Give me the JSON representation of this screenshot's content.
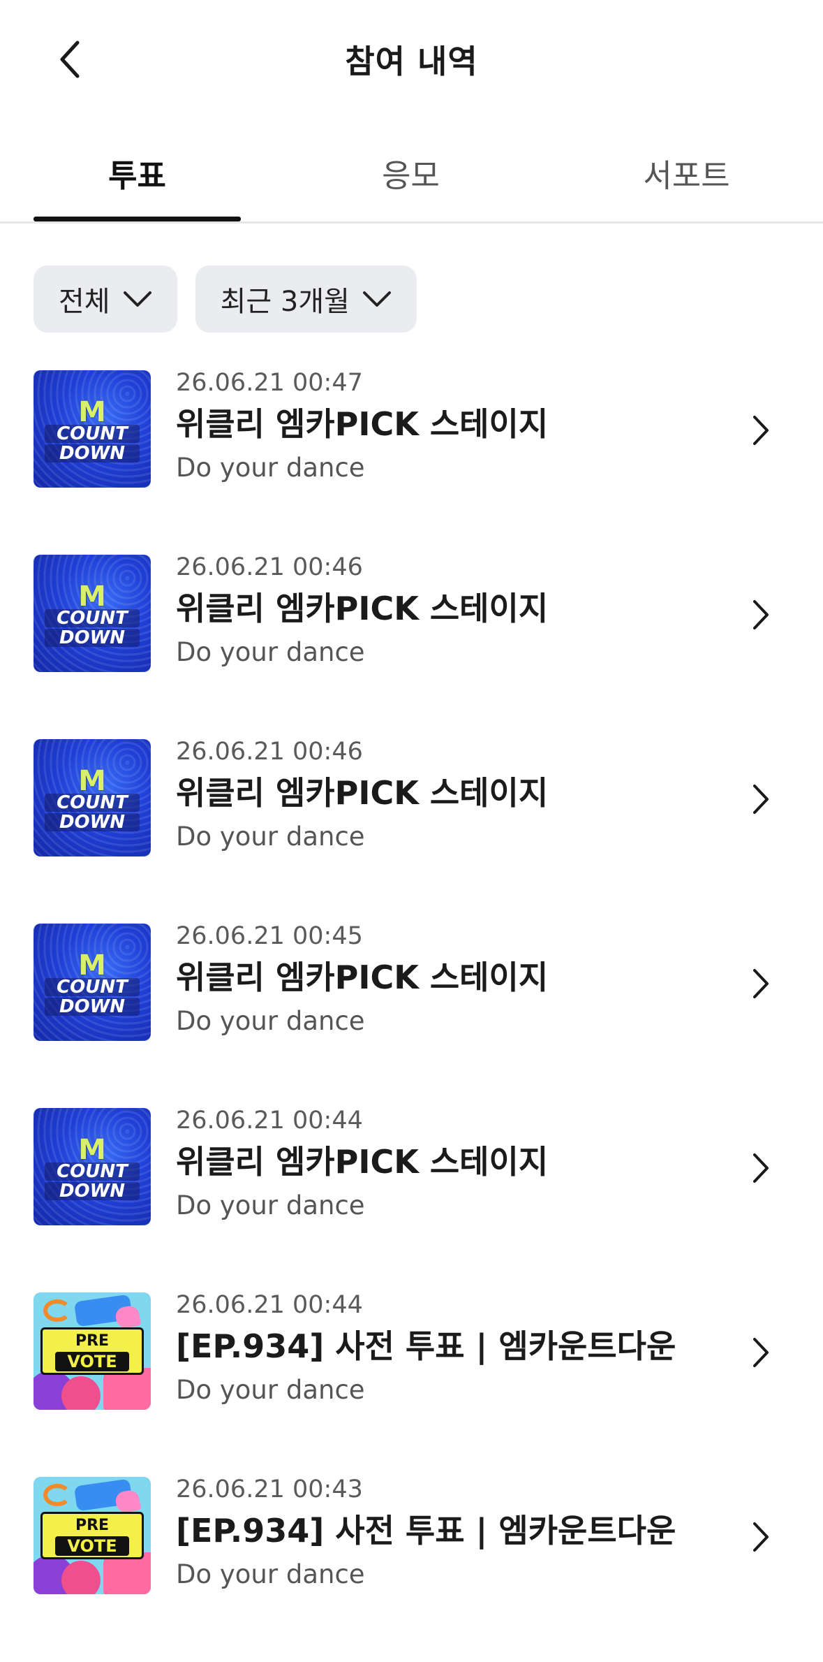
{
  "header": {
    "title": "참여 내역",
    "back_icon": "chevron-left-icon"
  },
  "tabs": [
    {
      "label": "투표",
      "active": true
    },
    {
      "label": "응모",
      "active": false
    },
    {
      "label": "서포트",
      "active": false
    }
  ],
  "filters": {
    "type": {
      "label": "전체",
      "icon": "chevron-down-icon"
    },
    "period": {
      "label": "최근 3개월",
      "icon": "chevron-down-icon"
    }
  },
  "thumbnails": {
    "mcountdown": {
      "m": "M",
      "line1": "COUNT",
      "line2": "DOWN"
    },
    "prevote": {
      "line1": "PRE",
      "line2": "VOTE"
    }
  },
  "items": [
    {
      "date": "26.06.21 00:47",
      "title": "위클리 엠카PICK 스테이지",
      "subtitle": "Do your dance",
      "thumb": "mcountdown"
    },
    {
      "date": "26.06.21 00:46",
      "title": "위클리 엠카PICK 스테이지",
      "subtitle": "Do your dance",
      "thumb": "mcountdown"
    },
    {
      "date": "26.06.21 00:46",
      "title": "위클리 엠카PICK 스테이지",
      "subtitle": "Do your dance",
      "thumb": "mcountdown"
    },
    {
      "date": "26.06.21 00:45",
      "title": "위클리 엠카PICK 스테이지",
      "subtitle": "Do your dance",
      "thumb": "mcountdown"
    },
    {
      "date": "26.06.21 00:44",
      "title": "위클리 엠카PICK 스테이지",
      "subtitle": "Do your dance",
      "thumb": "mcountdown"
    },
    {
      "date": "26.06.21 00:44",
      "title": "[EP.934] 사전 투표 | 엠카운트다운",
      "subtitle": "Do your dance",
      "thumb": "prevote"
    },
    {
      "date": "26.06.21 00:43",
      "title": "[EP.934] 사전 투표 | 엠카운트다운",
      "subtitle": "Do your dance",
      "thumb": "prevote"
    }
  ],
  "colors": {
    "text": "#1a1a1a",
    "muted": "#555555",
    "chip_bg": "#ebecef",
    "divider": "#e6e6e8",
    "indicator": "#111111"
  }
}
